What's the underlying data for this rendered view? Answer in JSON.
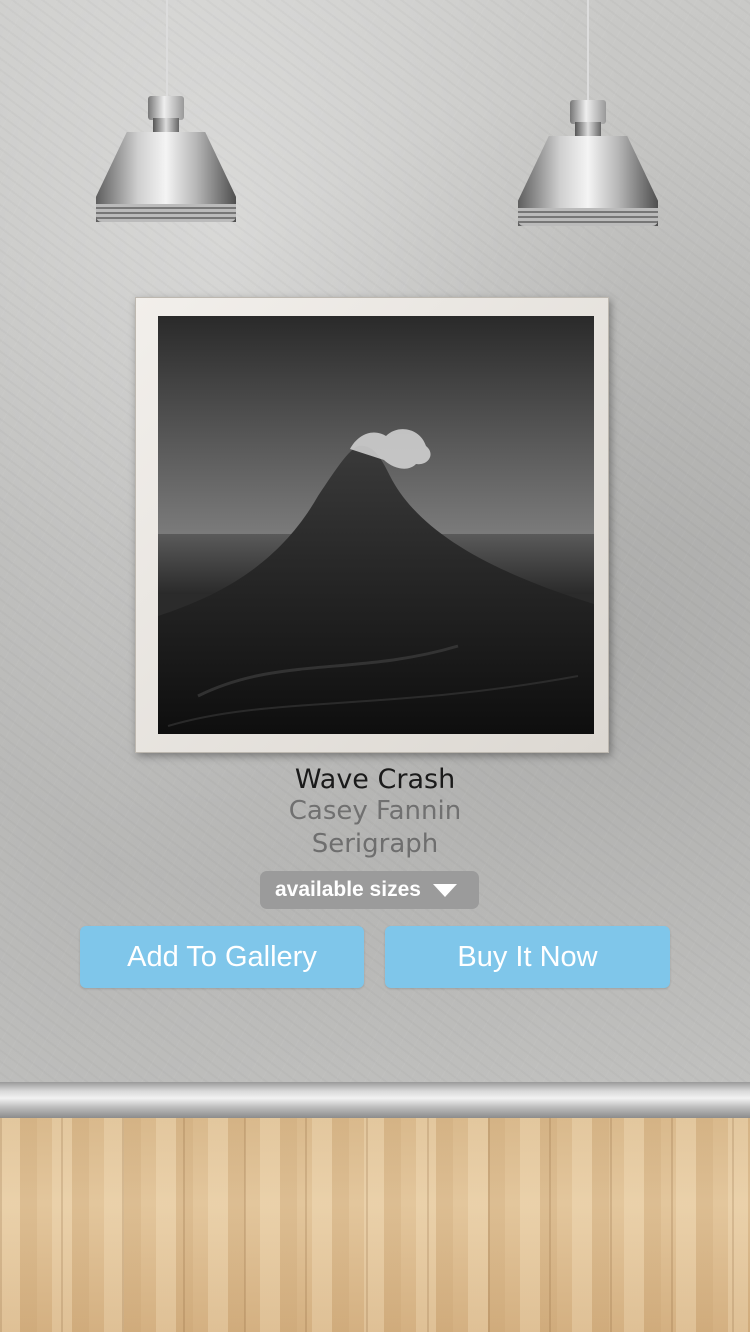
{
  "artwork": {
    "title": "Wave Crash",
    "artist": "Casey Fannin",
    "medium": "Serigraph"
  },
  "sizes": {
    "label": "available sizes",
    "icon": "chevron-down-icon"
  },
  "actions": {
    "add_to_gallery": "Add To Gallery",
    "buy_now": "Buy It Now"
  },
  "colors": {
    "button": "#7fc6ea",
    "sizes_bg": "#9b9b9b",
    "title": "#1a1a1a",
    "subtitle": "#707070"
  }
}
